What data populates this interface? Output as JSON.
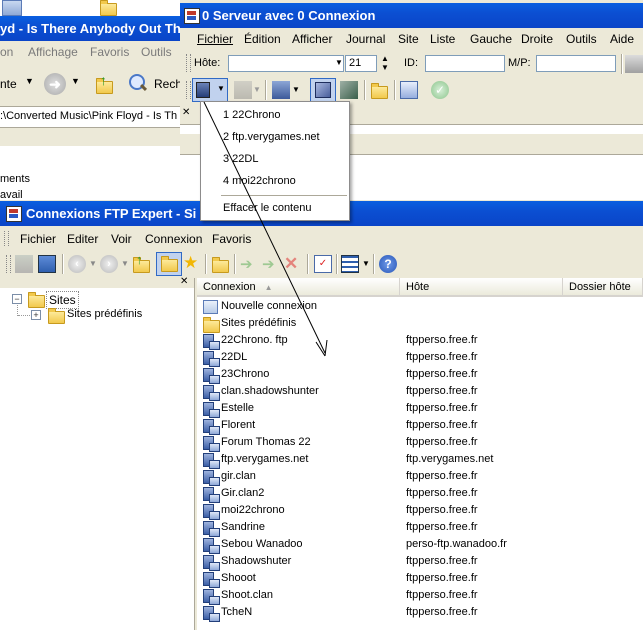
{
  "bg_window": {
    "title": "yd - Is There Anybody Out Th",
    "menu": [
      "on",
      "Affichage",
      "Favoris",
      "Outils"
    ],
    "nav_label": "nte",
    "search_label": "Rech",
    "address": ":\\Converted Music\\Pink Floyd - Is Th",
    "side_items": [
      "ments",
      "avail"
    ]
  },
  "server_window": {
    "title": "0 Serveur avec 0 Connexion",
    "menu": [
      "Fichier",
      "Édition",
      "Afficher",
      "Journal",
      "Site",
      "Liste",
      "Gauche",
      "Droite",
      "Outils",
      "Aide"
    ],
    "host_label": "Hôte:",
    "port_value": "21",
    "id_label": "ID:",
    "password_label": "M/P:"
  },
  "dropdown": {
    "items": [
      "1 22Chrono",
      "2 ftp.verygames.net",
      "3 22DL",
      "4 moi22chrono"
    ],
    "clear_label": "Effacer le contenu"
  },
  "ftp_window": {
    "title": "Connexions FTP Expert - Si",
    "menu": [
      "Fichier",
      "Editer",
      "Voir",
      "Connexion",
      "Favoris"
    ],
    "tree_root": "Sites",
    "tree_child": "Sites prédéfinis",
    "columns": [
      "Connexion",
      "Hôte",
      "Dossier hôte"
    ],
    "rows": [
      {
        "name": "Nouvelle connexion",
        "host": "",
        "icon": "new-connection-icon"
      },
      {
        "name": "Sites prédéfinis",
        "host": "",
        "icon": "folder-icon"
      },
      {
        "name": "22Chrono. ftp",
        "host": "ftpperso.free.fr",
        "icon": "server-icon"
      },
      {
        "name": "22DL",
        "host": "ftpperso.free.fr",
        "icon": "server-icon"
      },
      {
        "name": "23Chrono",
        "host": "ftpperso.free.fr",
        "icon": "server-icon"
      },
      {
        "name": "clan.shadowshunter",
        "host": "ftpperso.free.fr",
        "icon": "server-icon"
      },
      {
        "name": "Estelle",
        "host": "ftpperso.free.fr",
        "icon": "server-icon"
      },
      {
        "name": "Florent",
        "host": "ftpperso.free.fr",
        "icon": "server-icon"
      },
      {
        "name": "Forum Thomas 22",
        "host": "ftpperso.free.fr",
        "icon": "server-icon"
      },
      {
        "name": "ftp.verygames.net",
        "host": "ftp.verygames.net",
        "icon": "server-icon"
      },
      {
        "name": "gir.clan",
        "host": "ftpperso.free.fr",
        "icon": "server-icon"
      },
      {
        "name": "Gir.clan2",
        "host": "ftpperso.free.fr",
        "icon": "server-icon"
      },
      {
        "name": "moi22chrono",
        "host": "ftpperso.free.fr",
        "icon": "server-icon"
      },
      {
        "name": "Sandrine",
        "host": "ftpperso.free.fr",
        "icon": "server-icon"
      },
      {
        "name": "Sebou Wanadoo",
        "host": "perso-ftp.wanadoo.fr",
        "icon": "server-icon"
      },
      {
        "name": "Shadowshuter",
        "host": "ftpperso.free.fr",
        "icon": "server-icon"
      },
      {
        "name": "Shooot",
        "host": "ftpperso.free.fr",
        "icon": "server-icon"
      },
      {
        "name": "Shoot.clan",
        "host": "ftpperso.free.fr",
        "icon": "server-icon"
      },
      {
        "name": "TcheN",
        "host": "ftpperso.free.fr",
        "icon": "server-icon"
      }
    ]
  }
}
